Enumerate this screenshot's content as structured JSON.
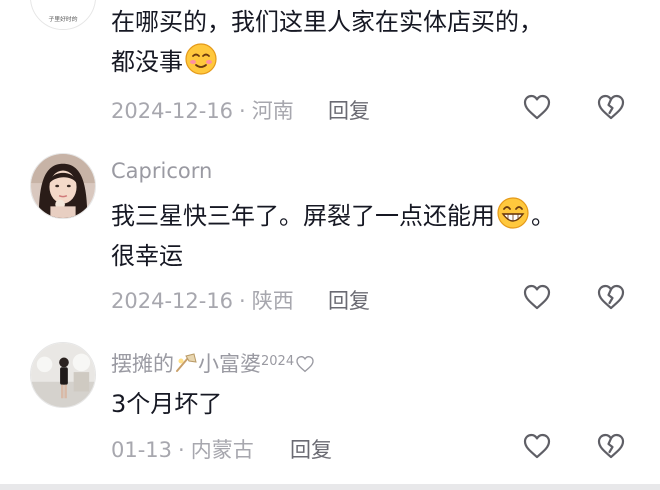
{
  "comments": [
    {
      "line1": "在哪买的，我们这里人家在实体店买的，",
      "line2": "都没事",
      "emoji_icon": "shushing-smile-emoji",
      "date": "2024-12-16",
      "location": "河南",
      "reply_label": "回复",
      "avatar_text": "子里好时的"
    },
    {
      "username": "Capricorn",
      "line1": "我三星快三年了。屏裂了一点还能用",
      "line1_tail": "。",
      "line2": "很幸运",
      "emoji_icon": "grinning-emoji",
      "date": "2024-12-16",
      "location": "陕西",
      "reply_label": "回复"
    },
    {
      "username_part1": "摆摊的",
      "username_part2": "小富婆",
      "username_part3": "2024",
      "line1": "3个月坏了",
      "date": "01-13",
      "location": "内蒙古",
      "reply_label": "回复"
    }
  ],
  "dot": "·",
  "colors": {
    "meta": "#a7a7ae",
    "username": "#9a9aa2",
    "text": "#161823",
    "icon": "#5f5f66"
  }
}
